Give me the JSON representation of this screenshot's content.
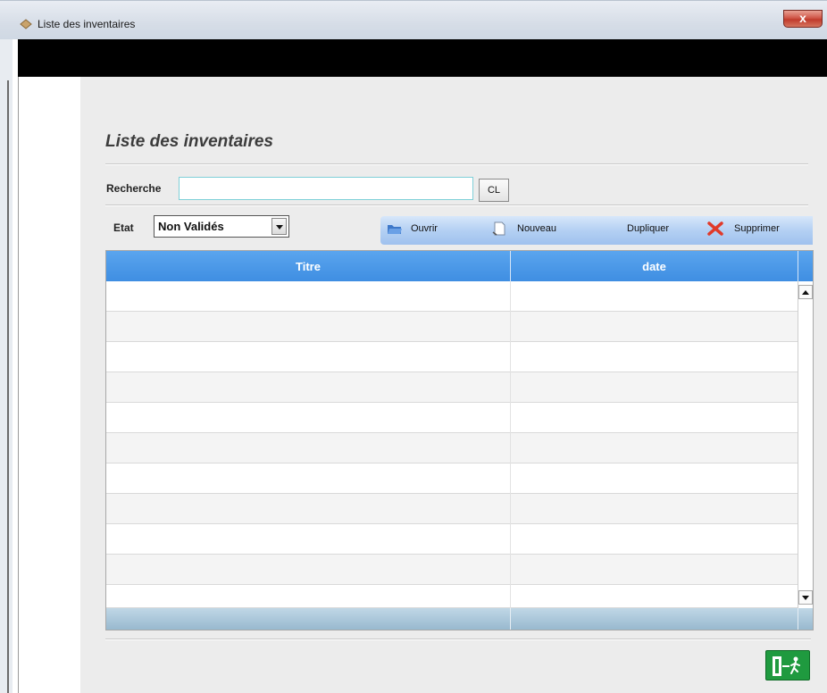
{
  "window": {
    "title": "Liste des inventaires",
    "close_label": "x"
  },
  "page": {
    "heading": "Liste des inventaires"
  },
  "search": {
    "label": "Recherche",
    "value": "",
    "clear_label": "CL"
  },
  "filter": {
    "label": "Etat",
    "selected": "Non Validés"
  },
  "toolbar": {
    "open_label": "Ouvrir",
    "new_label": "Nouveau",
    "duplicate_label": "Dupliquer",
    "delete_label": "Supprimer"
  },
  "table": {
    "columns": [
      "Titre",
      "date"
    ],
    "rows": []
  },
  "colors": {
    "header_blue": "#3f8ee2",
    "toolbar_blue": "#b4d0f3",
    "exit_green": "#1f9a3f",
    "delete_red": "#e03a2a"
  }
}
